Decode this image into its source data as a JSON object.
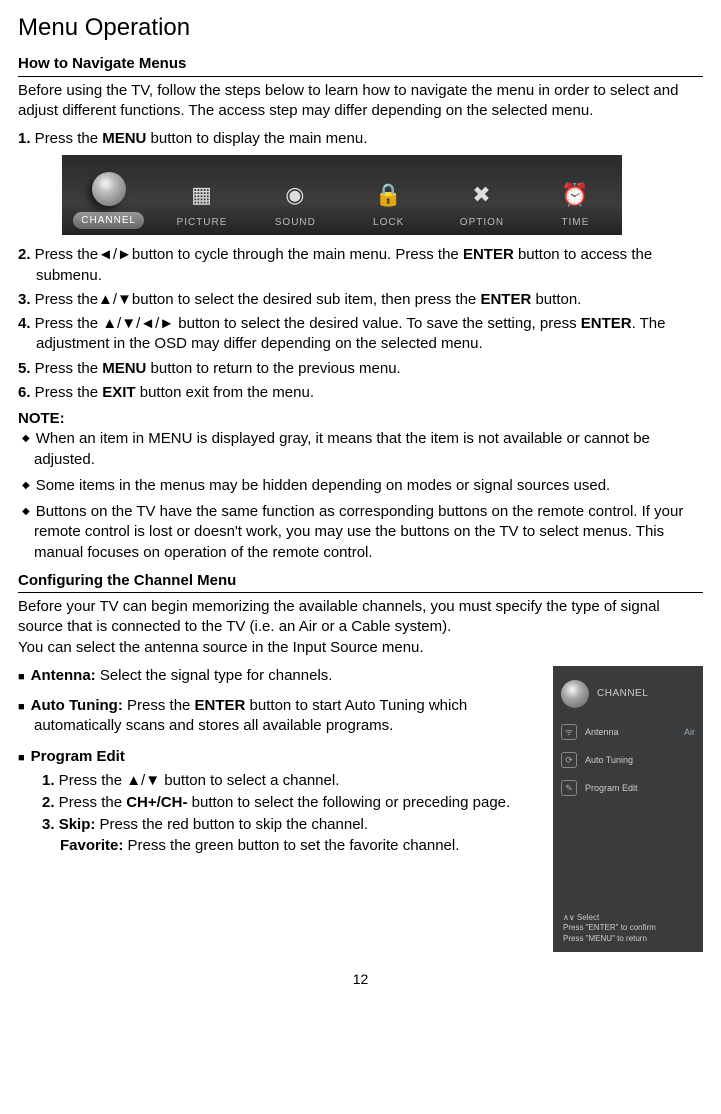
{
  "title": "Menu Operation",
  "sec1": {
    "heading": "How to Navigate Menus",
    "intro": "Before using the TV, follow the steps below to learn how to navigate the menu in order to select and adjust different functions. The access step may differ depending on the selected menu.",
    "s1n": "1.",
    "s1a": " Press the ",
    "s1b": "MENU",
    "s1c": " button to display the main menu.",
    "s2n": "2.",
    "s2a": " Press the◄/►button to cycle through the main menu. Press the ",
    "s2b": "ENTER",
    "s2c": " button to access the submenu.",
    "s3n": "3.",
    "s3a": " Press the▲/▼button to select the desired sub item, then press the ",
    "s3b": "ENTER",
    "s3c": " button.",
    "s4n": "4.",
    "s4a": " Press the ▲/▼/◄/► button to select the desired value. To save the setting, press ",
    "s4b": "ENTER",
    "s4c": ". The adjustment in the OSD may differ depending on the selected menu.",
    "s5n": "5.",
    "s5a": " Press the ",
    "s5b": "MENU",
    "s5c": " button to return to the previous menu.",
    "s6n": "6.",
    "s6a": " Press the ",
    "s6b": "EXIT",
    "s6c": " button exit from the menu.",
    "note_label": "NOTE:",
    "n1": "When an item in MENU is displayed gray, it means that the item is not available or cannot be adjusted.",
    "n2": "Some items in the menus may be hidden depending on modes or signal sources used.",
    "n3": "Buttons on the TV have the same function as corresponding buttons on the remote control. If your remote control is lost or doesn't work, you may use the buttons on the TV to select menus. This manual focuses on operation of the remote control."
  },
  "menubar": {
    "items": [
      {
        "label": "CHANNEL"
      },
      {
        "label": "PICTURE"
      },
      {
        "label": "SOUND"
      },
      {
        "label": "LOCK"
      },
      {
        "label": "OPTION"
      },
      {
        "label": "TIME"
      }
    ]
  },
  "sec2": {
    "heading": "Configuring the Channel Menu",
    "p1": "Before your TV can begin memorizing the available channels, you must specify the type of signal source that is connected to the TV (i.e. an Air or a Cable system).",
    "p2": "You can select the antenna source in the Input Source menu.",
    "ant_b": "Antenna:",
    "ant_t": " Select the signal type for channels.",
    "at_b": "Auto Tuning:",
    "at_t1": " Press the ",
    "at_t2": "ENTER",
    "at_t3": " button to start Auto Tuning which automatically scans and stores all available programs.",
    "pe_b": "Program Edit",
    "pe1n": "1.",
    "pe1t": " Press the ▲/▼ button to select a channel.",
    "pe2n": "2.",
    "pe2a": " Press the ",
    "pe2b": "CH+/CH-",
    "pe2c": " button to select the following or preceding page.",
    "pe3n": "3. ",
    "pe3b1": "Skip:",
    "pe3t1": " Press the red button to skip the channel.",
    "pe3b2": "Favorite:",
    "pe3t2": " Press the green button to set the favorite channel."
  },
  "panel": {
    "title": "CHANNEL",
    "r1": "Antenna",
    "r1v": "Air",
    "r2": "Auto Tuning",
    "r3": "Program Edit",
    "f1": "∧∨ Select",
    "f2": "Press \"ENTER\" to confirm",
    "f3": "Press \"MENU\" to return"
  },
  "page_no": "12"
}
